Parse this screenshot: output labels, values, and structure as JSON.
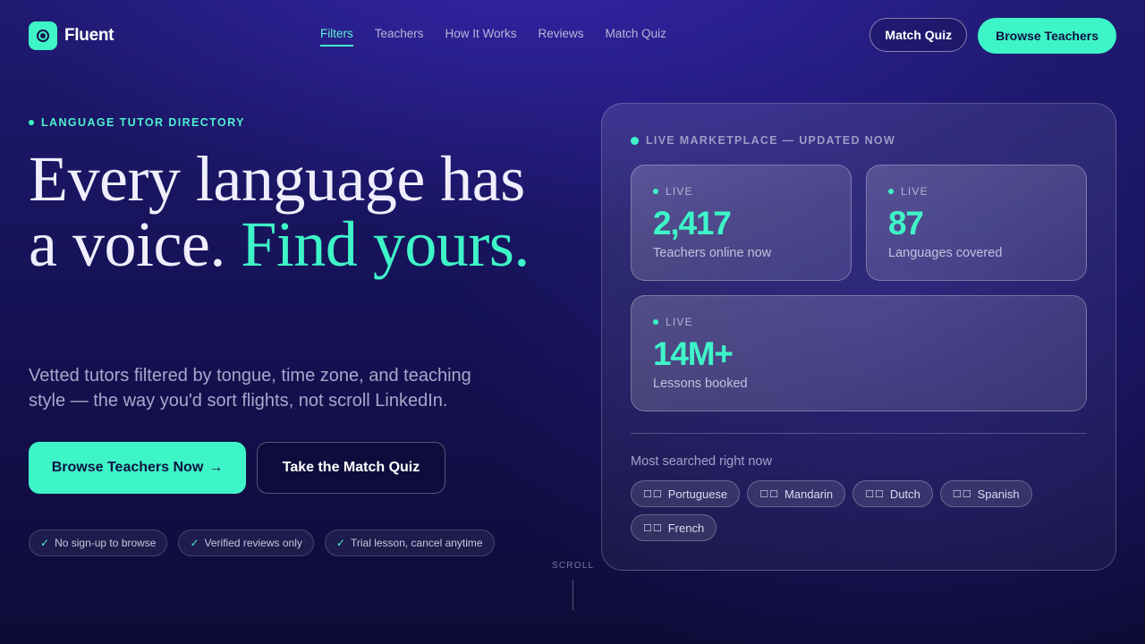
{
  "brand": {
    "name": "Fluent",
    "icon": "target-logo-icon"
  },
  "nav": {
    "links": [
      {
        "label": "Filters",
        "active": true
      },
      {
        "label": "Teachers",
        "active": false
      },
      {
        "label": "How It Works",
        "active": false
      },
      {
        "label": "Reviews",
        "active": false
      },
      {
        "label": "Match Quiz",
        "active": false
      }
    ],
    "match_quiz_button": "Match Quiz",
    "browse_button": "Browse Teachers"
  },
  "hero": {
    "eyebrow": "LANGUAGE TUTOR DIRECTORY",
    "headline_part1": "Every language has a voice.",
    "headline_accent": "Find yours.",
    "subhead": "Vetted tutors filtered by tongue, time zone, and teaching style — the way you'd sort flights, not scroll LinkedIn.",
    "primary_cta": "Browse Teachers Now",
    "primary_cta_arrow": "→",
    "secondary_cta": "Take the Match Quiz",
    "trust_badges": [
      {
        "icon": "✓",
        "label": "No sign-up to browse"
      },
      {
        "icon": "✓",
        "label": "Verified reviews only"
      },
      {
        "icon": "✓",
        "label": "Trial lesson, cancel anytime"
      }
    ],
    "scroll_label": "SCROLL"
  },
  "panel": {
    "heading": "LIVE MARKETPLACE — UPDATED NOW",
    "stats": [
      {
        "live": "LIVE",
        "value": "2,417",
        "label": "Teachers online now"
      },
      {
        "live": "LIVE",
        "value": "87",
        "label": "Languages covered"
      },
      {
        "live": "LIVE",
        "value": "14M+",
        "label": "Lessons booked"
      }
    ],
    "searched_title": "Most searched right now",
    "languages": [
      {
        "flag": "☐☐",
        "label": "Portuguese"
      },
      {
        "flag": "☐☐",
        "label": "Mandarin"
      },
      {
        "flag": "☐☐",
        "label": "Dutch"
      },
      {
        "flag": "☐☐",
        "label": "Spanish"
      },
      {
        "flag": "☐☐",
        "label": "French"
      }
    ]
  },
  "colors": {
    "accent": "#3ef5c8",
    "background": "#17135a",
    "text_muted": "#a9a6cc"
  }
}
